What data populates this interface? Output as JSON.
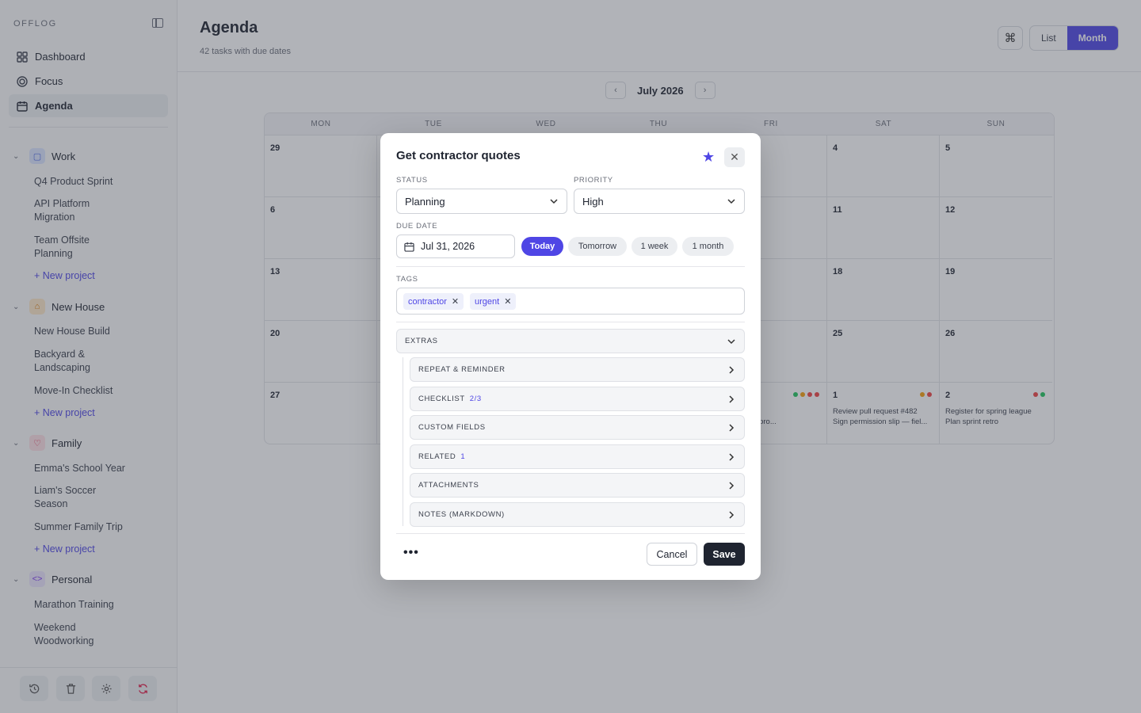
{
  "sidebar": {
    "brand": "OFFLOG",
    "nav": [
      {
        "label": "Dashboard",
        "icon": "grid-icon"
      },
      {
        "label": "Focus",
        "icon": "target-icon"
      },
      {
        "label": "Agenda",
        "icon": "calendar-icon",
        "active": true
      }
    ],
    "groups": [
      {
        "name": "Work",
        "icon": "briefcase-icon",
        "color": "#dbe4ff",
        "projects": [
          "Q4 Product Sprint",
          "API Platform Migration",
          "Team Offsite Planning"
        ],
        "new_label": "+ New project"
      },
      {
        "name": "New House",
        "icon": "house-icon",
        "color": "#fde8c8",
        "projects": [
          "New House Build",
          "Backyard & Landscaping",
          "Move-In Checklist"
        ],
        "new_label": "+ New project"
      },
      {
        "name": "Family",
        "icon": "heart-icon",
        "color": "#fde0e4",
        "projects": [
          "Emma's School Year",
          "Liam's Soccer Season",
          "Summer Family Trip"
        ],
        "new_label": "+ New project"
      },
      {
        "name": "Personal",
        "icon": "code-icon",
        "color": "#ece4fd",
        "projects": [
          "Marathon Training",
          "Weekend Woodworking"
        ],
        "new_label": ""
      }
    ],
    "footer_icons": [
      "history-icon",
      "trash-icon",
      "gear-icon",
      "sync-icon"
    ]
  },
  "header": {
    "title": "Agenda",
    "subtitle": "42 tasks with due dates",
    "cmd_glyph": "⌘",
    "view_list": "List",
    "view_month": "Month"
  },
  "calendar": {
    "month_label": "July 2026",
    "prev": "‹",
    "next": "›",
    "weekdays": [
      "MON",
      "TUE",
      "WED",
      "THU",
      "FRI",
      "SAT",
      "SUN"
    ],
    "weeks": [
      [
        "29",
        "",
        "",
        "",
        "",
        "4",
        "5"
      ],
      [
        "6",
        "",
        "",
        "",
        "",
        "11",
        "12"
      ],
      [
        "13",
        "",
        "",
        "",
        "",
        "18",
        "19"
      ],
      [
        "20",
        "",
        "",
        "",
        "",
        "25",
        "26"
      ],
      [
        "27",
        "",
        "",
        "",
        "",
        "1",
        "2"
      ]
    ],
    "visible_tasks": {
      "fri_last": [
        "rees",
        "onstruction pro..."
      ],
      "sat_last": [
        "Review pull request #482",
        "Sign permission slip — fiel..."
      ],
      "sun_last": [
        "Register for spring league",
        "Plan sprint retro"
      ]
    },
    "dot_colors": {
      "fri_last": [
        "#22c55e",
        "#f59e0b",
        "#ef4444",
        "#ef4444"
      ],
      "sat_last": [
        "#f59e0b",
        "#ef4444"
      ],
      "sun_last": [
        "#ef4444",
        "#22c55e"
      ]
    }
  },
  "modal": {
    "title": "Get contractor quotes",
    "status_label": "STATUS",
    "status_value": "Planning",
    "priority_label": "PRIORITY",
    "priority_value": "High",
    "due_label": "DUE DATE",
    "due_value": "Jul 31, 2026",
    "quick_dates": [
      "Today",
      "Tomorrow",
      "1 week",
      "1 month"
    ],
    "tags_label": "TAGS",
    "tags": [
      "contractor",
      "urgent"
    ],
    "extras_label": "EXTRAS",
    "sections": [
      {
        "label": "REPEAT & REMINDER",
        "count": ""
      },
      {
        "label": "CHECKLIST",
        "count": "2/3"
      },
      {
        "label": "CUSTOM FIELDS",
        "count": ""
      },
      {
        "label": "RELATED",
        "count": "1"
      },
      {
        "label": "ATTACHMENTS",
        "count": ""
      },
      {
        "label": "NOTES (MARKDOWN)",
        "count": ""
      }
    ],
    "more": "•••",
    "cancel": "Cancel",
    "save": "Save"
  },
  "colors": {
    "accent": "#4f46e5",
    "dark": "#1f2430"
  }
}
